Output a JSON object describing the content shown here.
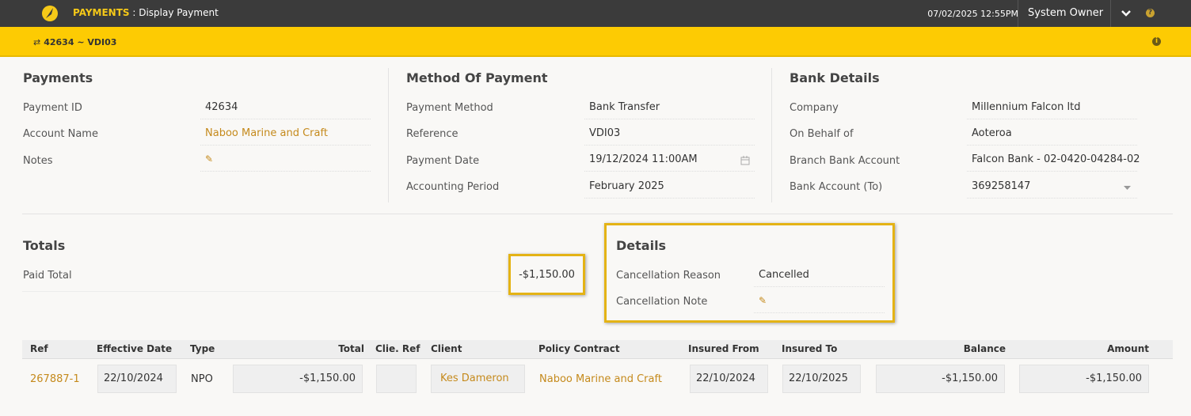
{
  "topbar": {
    "module": "PAYMENTS",
    "page": " : Display Payment",
    "datetime": "07/02/2025 12:55PM",
    "user": "System Owner"
  },
  "record": {
    "label": "42634 ~ VDI03"
  },
  "payments": {
    "title": "Payments",
    "fields": [
      {
        "label": "Payment ID",
        "value": "42634"
      },
      {
        "label": "Account Name",
        "value": "Naboo Marine and Craft"
      },
      {
        "label": "Notes",
        "value": ""
      }
    ]
  },
  "method": {
    "title": "Method Of Payment",
    "fields": [
      {
        "label": "Payment Method",
        "value": "Bank Transfer"
      },
      {
        "label": "Reference",
        "value": "VDI03"
      },
      {
        "label": "Payment Date",
        "value": "19/12/2024 11:00AM"
      },
      {
        "label": "Accounting Period",
        "value": "February 2025"
      }
    ]
  },
  "bank": {
    "title": "Bank Details",
    "fields": [
      {
        "label": "Company",
        "value": "Millennium Falcon ltd"
      },
      {
        "label": "On Behalf of",
        "value": "Aoteroa"
      },
      {
        "label": "Branch Bank Account",
        "value": "Falcon Bank - 02-0420-04284-02"
      },
      {
        "label": "Bank Account (To)",
        "value": "369258147"
      }
    ]
  },
  "totals": {
    "title": "Totals",
    "paid_label": "Paid Total",
    "paid_value": "-$1,150.00"
  },
  "details": {
    "title": "Details",
    "reason_label": "Cancellation Reason",
    "reason_value": "Cancelled",
    "note_label": "Cancellation Note"
  },
  "table": {
    "headers": [
      "Ref",
      "Effective Date",
      "Type",
      "Total",
      "Clie. Ref",
      "Client",
      "Policy Contract",
      "Insured From",
      "Insured To",
      "Balance",
      "Amount"
    ],
    "rows": [
      {
        "ref": "267887-1",
        "effective_date": "22/10/2024",
        "type": "NPO",
        "total": "-$1,150.00",
        "client_ref": "",
        "client": "Kes Dameron",
        "policy_contract": "Naboo Marine and Craft",
        "insured_from": "22/10/2024",
        "insured_to": "22/10/2025",
        "balance": "-$1,150.00",
        "amount": "-$1,150.00"
      }
    ]
  },
  "colors": {
    "accent": "#fdcb03",
    "link": "#c58a1c",
    "topbar": "#3b3b3b"
  }
}
